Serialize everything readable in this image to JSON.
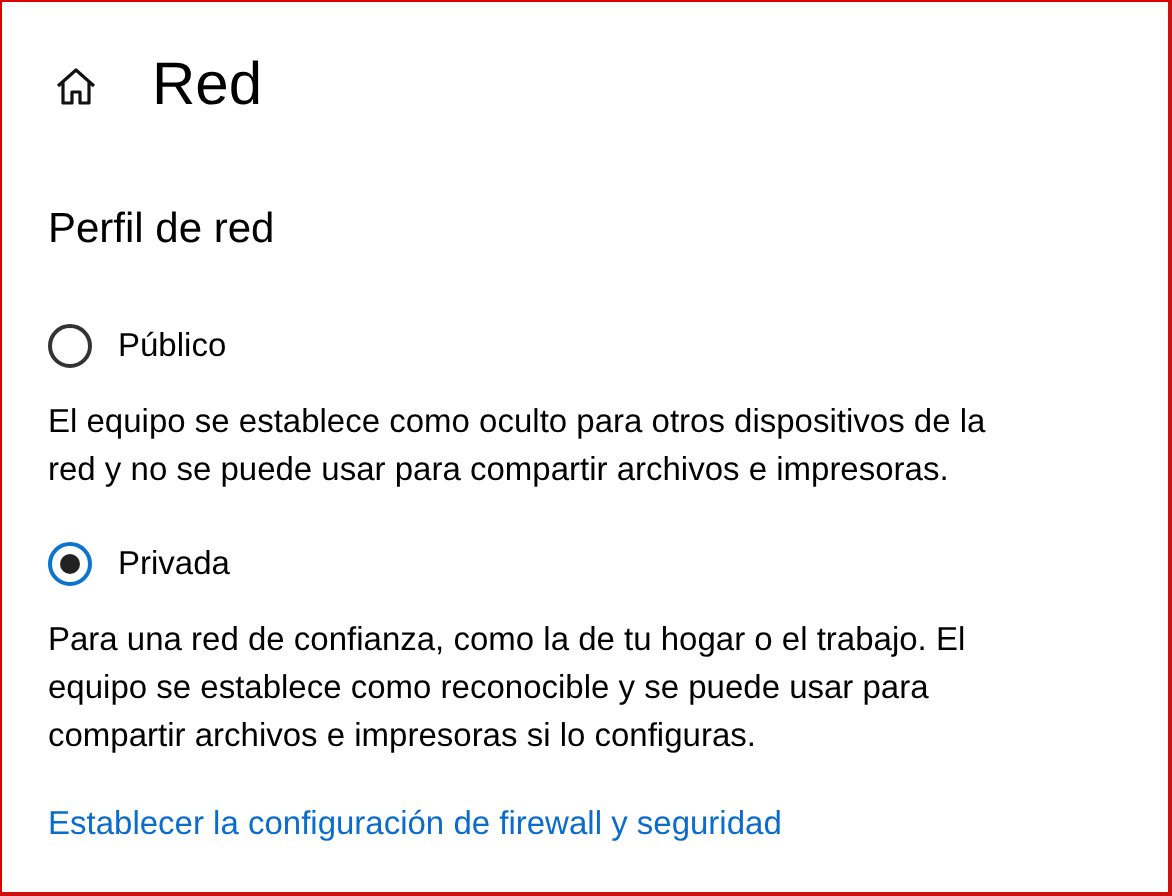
{
  "page": {
    "title": "Red"
  },
  "section": {
    "title": "Perfil de red"
  },
  "options": [
    {
      "label": "Público",
      "selected": false,
      "description": [
        "El equipo se establece como oculto para otros dispositivos de la",
        "red y no se puede usar para compartir archivos e impresoras."
      ]
    },
    {
      "label": "Privada",
      "selected": true,
      "description": [
        "Para una red de confianza, como la de tu hogar o el trabajo. El",
        "equipo se establece como reconocible y se puede usar para",
        "compartir archivos e impresoras si lo configuras."
      ]
    }
  ],
  "link": "Establecer la configuración de firewall y seguridad"
}
